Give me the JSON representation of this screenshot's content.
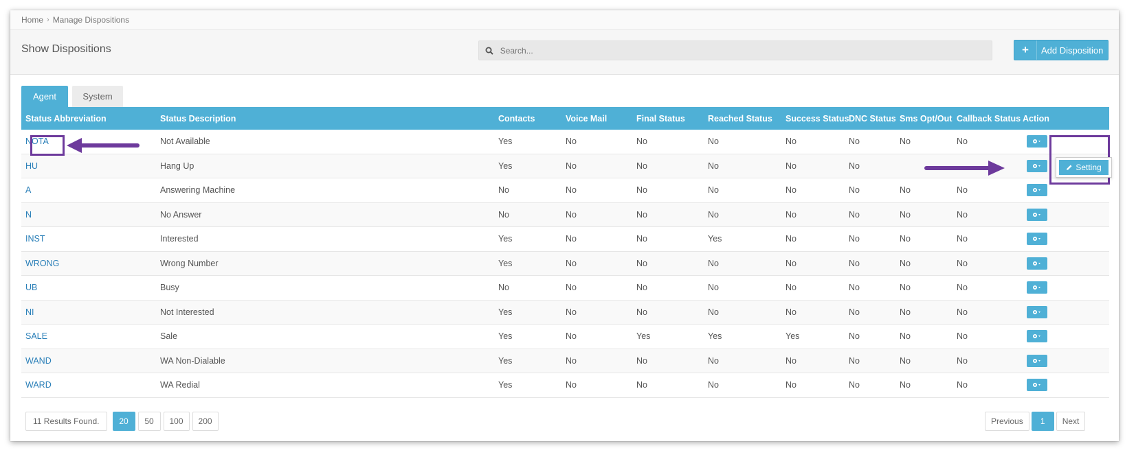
{
  "breadcrumb": {
    "home": "Home",
    "separator": "›",
    "current": "Manage Dispositions"
  },
  "header": {
    "title": "Show Dispositions",
    "search_placeholder": "Search...",
    "add_label": "Add Disposition"
  },
  "tabs": [
    {
      "label": "Agent",
      "active": true
    },
    {
      "label": "System",
      "active": false
    }
  ],
  "table": {
    "columns": [
      "Status Abbreviation",
      "Status Description",
      "Contacts",
      "Voice Mail",
      "Final Status",
      "Reached Status",
      "Success Status",
      "DNC Status",
      "Sms Opt/Out",
      "Callback Status",
      "Action"
    ],
    "rows": [
      [
        "NOTA",
        "Not Available",
        "Yes",
        "No",
        "No",
        "No",
        "No",
        "No",
        "No",
        "No"
      ],
      [
        "HU",
        "Hang Up",
        "Yes",
        "No",
        "No",
        "No",
        "No",
        "No",
        "",
        ""
      ],
      [
        "A",
        "Answering Machine",
        "No",
        "No",
        "No",
        "No",
        "No",
        "No",
        "No",
        "No"
      ],
      [
        "N",
        "No Answer",
        "No",
        "No",
        "No",
        "No",
        "No",
        "No",
        "No",
        "No"
      ],
      [
        "INST",
        "Interested",
        "Yes",
        "No",
        "No",
        "Yes",
        "No",
        "No",
        "No",
        "No"
      ],
      [
        "WRONG",
        "Wrong Number",
        "Yes",
        "No",
        "No",
        "No",
        "No",
        "No",
        "No",
        "No"
      ],
      [
        "UB",
        "Busy",
        "No",
        "No",
        "No",
        "No",
        "No",
        "No",
        "No",
        "No"
      ],
      [
        "NI",
        "Not Interested",
        "Yes",
        "No",
        "No",
        "No",
        "No",
        "No",
        "No",
        "No"
      ],
      [
        "SALE",
        "Sale",
        "Yes",
        "No",
        "Yes",
        "Yes",
        "Yes",
        "No",
        "No",
        "No"
      ],
      [
        "WAND",
        "WA Non-Dialable",
        "Yes",
        "No",
        "No",
        "No",
        "No",
        "No",
        "No",
        "No"
      ],
      [
        "WARD",
        "WA Redial",
        "Yes",
        "No",
        "No",
        "No",
        "No",
        "No",
        "No",
        "No"
      ]
    ]
  },
  "dropdown": {
    "setting_label": "Setting"
  },
  "footer": {
    "results": "11 Results Found.",
    "page_sizes": [
      "20",
      "50",
      "100",
      "200"
    ],
    "active_page_size": "20",
    "pager": {
      "previous": "Previous",
      "current": "1",
      "next": "Next"
    }
  },
  "colors": {
    "accent": "#4fb0d6",
    "annotation": "#6d3a9c",
    "link": "#2a7fb8"
  },
  "icons": {
    "search": "search-icon",
    "gear": "gear-icon",
    "pencil": "pencil-icon",
    "plus": "plus-icon"
  }
}
